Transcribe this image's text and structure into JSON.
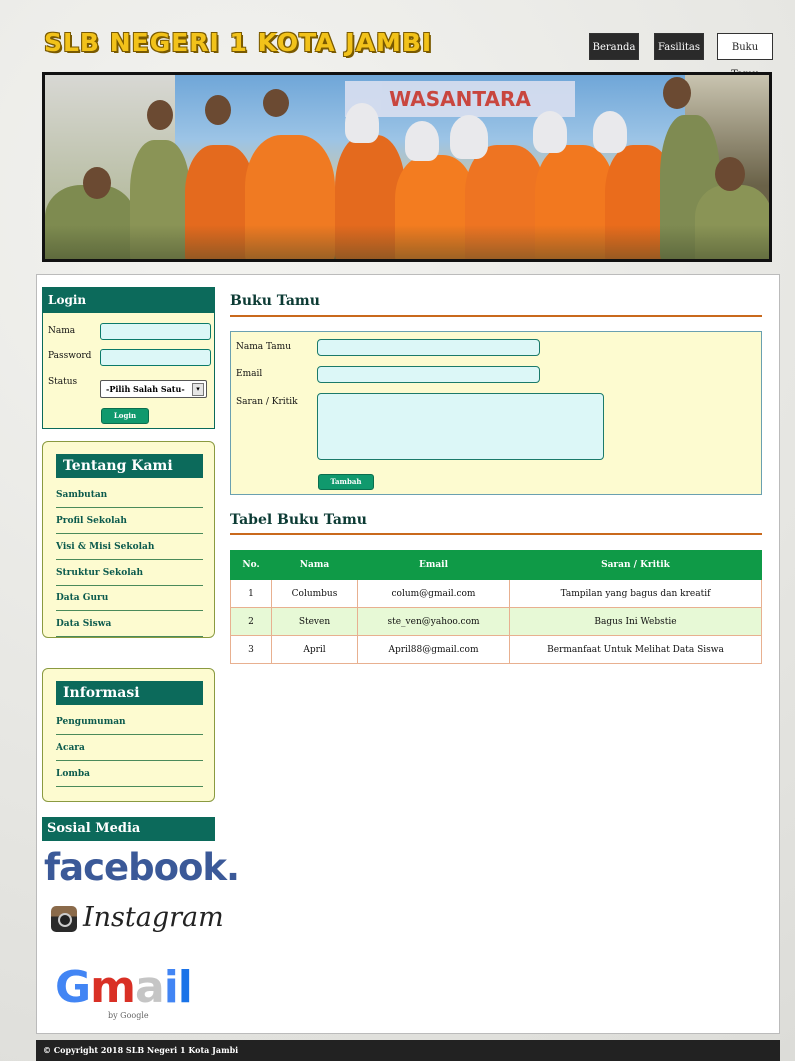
{
  "site": {
    "title": "SLB NEGERI 1 KOTA JAMBI"
  },
  "nav": {
    "items": [
      {
        "label": "Beranda",
        "style": "dark"
      },
      {
        "label": "Fasilitas",
        "style": "dark"
      },
      {
        "label": "Buku Tamu",
        "style": "light"
      }
    ]
  },
  "banner": {
    "sign_text": "WASANTARA"
  },
  "login": {
    "title": "Login",
    "name_label": "Nama",
    "password_label": "Password",
    "status_label": "Status",
    "status_selected": "-Pilih Salah Satu-",
    "button_label": "Login"
  },
  "tentang": {
    "title": "Tentang Kami",
    "items": [
      "Sambutan",
      "Profil Sekolah",
      "Visi & Misi Sekolah",
      "Struktur Sekolah",
      "Data Guru",
      "Data Siswa"
    ]
  },
  "informasi": {
    "title": "Informasi",
    "items": [
      "Pengumuman",
      "Acara",
      "Lomba"
    ]
  },
  "sosial": {
    "title": "Sosial Media",
    "facebook": "facebook.",
    "instagram": "Instagram",
    "gmail": "Gmail",
    "gmail_by": "by Google"
  },
  "bukutamu": {
    "title": "Buku Tamu",
    "name_label": "Nama Tamu",
    "email_label": "Email",
    "saran_label": "Saran / Kritik",
    "submit_label": "Tambah"
  },
  "tabel": {
    "title": "Tabel Buku Tamu",
    "headers": [
      "No.",
      "Nama",
      "Email",
      "Saran / Kritik"
    ],
    "rows": [
      [
        "1",
        "Columbus",
        "colum@gmail.com",
        "Tampilan yang bagus dan kreatif"
      ],
      [
        "2",
        "Steven",
        "ste_ven@yahoo.com",
        "Bagus Ini Webstie"
      ],
      [
        "3",
        "April",
        "April88@gmail.com",
        "Bermanfaat Untuk Melihat Data Siswa"
      ]
    ]
  },
  "footer": {
    "copyright": "© Copyright 2018 SLB Negeri 1 Kota Jambi"
  },
  "colors": {
    "primary": "#0c6a5b",
    "accent": "#c9691c",
    "table_header": "#0f9a47",
    "panel": "#fdfbd0"
  }
}
